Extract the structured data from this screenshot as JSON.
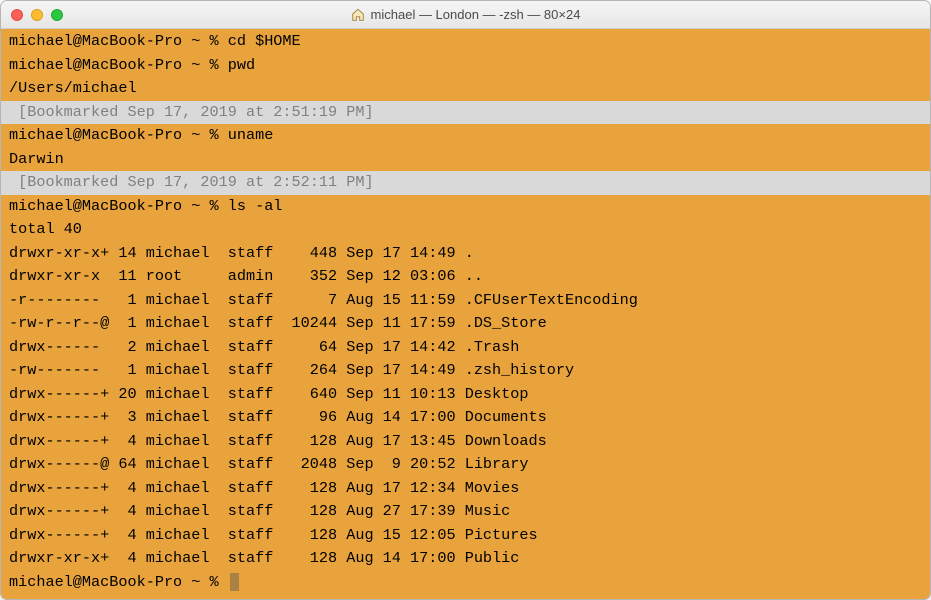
{
  "window": {
    "title": "michael — London — -zsh — 80×24",
    "title_icon": "home-icon"
  },
  "traffic_lights": {
    "close": "close",
    "minimize": "minimize",
    "maximize": "maximize"
  },
  "colors": {
    "terminal_bg": "#e8a33d",
    "bookmark_bg": "#d9d9d9",
    "bookmark_fg": "#808080"
  },
  "terminal": {
    "prompt": "michael@MacBook-Pro ~ % ",
    "lines": [
      {
        "type": "cmd",
        "text": "michael@MacBook-Pro ~ % cd $HOME"
      },
      {
        "type": "cmd",
        "text": "michael@MacBook-Pro ~ % pwd"
      },
      {
        "type": "out",
        "text": "/Users/michael"
      },
      {
        "type": "bookmark",
        "text": " [Bookmarked Sep 17, 2019 at 2:51:19 PM]"
      },
      {
        "type": "cmd",
        "text": "michael@MacBook-Pro ~ % uname"
      },
      {
        "type": "out",
        "text": "Darwin"
      },
      {
        "type": "bookmark",
        "text": " [Bookmarked Sep 17, 2019 at 2:52:11 PM]"
      },
      {
        "type": "cmd",
        "text": "michael@MacBook-Pro ~ % ls -al"
      },
      {
        "type": "out",
        "text": "total 40"
      },
      {
        "type": "out",
        "text": "drwxr-xr-x+ 14 michael  staff    448 Sep 17 14:49 ."
      },
      {
        "type": "out",
        "text": "drwxr-xr-x  11 root     admin    352 Sep 12 03:06 .."
      },
      {
        "type": "out",
        "text": "-r--------   1 michael  staff      7 Aug 15 11:59 .CFUserTextEncoding"
      },
      {
        "type": "out",
        "text": "-rw-r--r--@  1 michael  staff  10244 Sep 11 17:59 .DS_Store"
      },
      {
        "type": "out",
        "text": "drwx------   2 michael  staff     64 Sep 17 14:42 .Trash"
      },
      {
        "type": "out",
        "text": "-rw-------   1 michael  staff    264 Sep 17 14:49 .zsh_history"
      },
      {
        "type": "out",
        "text": "drwx------+ 20 michael  staff    640 Sep 11 10:13 Desktop"
      },
      {
        "type": "out",
        "text": "drwx------+  3 michael  staff     96 Aug 14 17:00 Documents"
      },
      {
        "type": "out",
        "text": "drwx------+  4 michael  staff    128 Aug 17 13:45 Downloads"
      },
      {
        "type": "out",
        "text": "drwx------@ 64 michael  staff   2048 Sep  9 20:52 Library"
      },
      {
        "type": "out",
        "text": "drwx------+  4 michael  staff    128 Aug 17 12:34 Movies"
      },
      {
        "type": "out",
        "text": "drwx------+  4 michael  staff    128 Aug 27 17:39 Music"
      },
      {
        "type": "out",
        "text": "drwx------+  4 michael  staff    128 Aug 15 12:05 Pictures"
      },
      {
        "type": "out",
        "text": "drwxr-xr-x+  4 michael  staff    128 Aug 14 17:00 Public"
      },
      {
        "type": "prompt",
        "text": "michael@MacBook-Pro ~ % "
      }
    ]
  }
}
